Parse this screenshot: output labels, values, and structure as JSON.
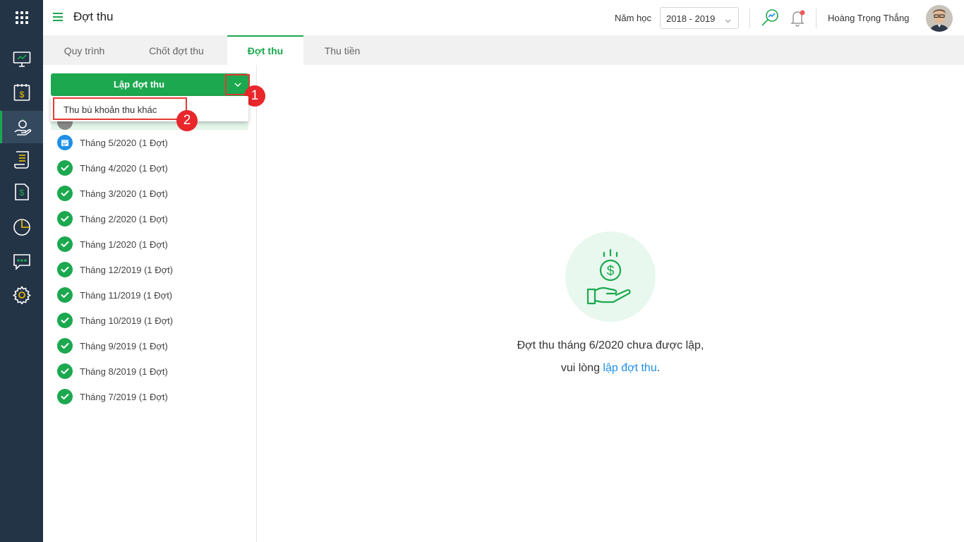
{
  "header": {
    "title": "Đợt thu",
    "year_label": "Năm học",
    "year_value": "2018 - 2019",
    "user_name": "Hoàng Trọng  Thắng"
  },
  "tabs": [
    {
      "label": "Quy trình"
    },
    {
      "label": "Chốt đợt thu"
    },
    {
      "label": "Đợt thu"
    },
    {
      "label": "Thu tiền"
    }
  ],
  "actions": {
    "create_label": "Lập đợt thu",
    "dropdown_item": "Thu bù khoản thu khác"
  },
  "callouts": {
    "one": "1",
    "two": "2"
  },
  "periods": [
    {
      "label": "Tháng 5/2020 (1 Đợt)",
      "status": "current"
    },
    {
      "label": "Tháng 4/2020 (1 Đợt)",
      "status": "done"
    },
    {
      "label": "Tháng 3/2020 (1 Đợt)",
      "status": "done"
    },
    {
      "label": "Tháng 2/2020 (1 Đợt)",
      "status": "done"
    },
    {
      "label": "Tháng 1/2020 (1 Đợt)",
      "status": "done"
    },
    {
      "label": "Tháng 12/2019 (1 Đợt)",
      "status": "done"
    },
    {
      "label": "Tháng 11/2019 (1 Đợt)",
      "status": "done"
    },
    {
      "label": "Tháng 10/2019 (1 Đợt)",
      "status": "done"
    },
    {
      "label": "Tháng 9/2019 (1 Đợt)",
      "status": "done"
    },
    {
      "label": "Tháng 8/2019 (1 Đợt)",
      "status": "done"
    },
    {
      "label": "Tháng 7/2019 (1 Đợt)",
      "status": "done"
    }
  ],
  "empty_state": {
    "line1": "Đợt thu tháng 6/2020 chưa được lập,",
    "line2_prefix": "vui lòng ",
    "line2_link": "lập đợt thu",
    "line2_suffix": "."
  },
  "colors": {
    "accent": "#1ca84f",
    "sidebar": "#243447",
    "link": "#1e8fe8",
    "highlight": "#e53935"
  },
  "icons": {
    "rail": [
      "apps-grid-icon",
      "monitor-icon",
      "calendar-money-icon",
      "hand-coin-icon",
      "receipt-list-icon",
      "invoice-icon",
      "pie-chart-icon",
      "chat-icon",
      "settings-gear-icon"
    ],
    "header": [
      "hamburger-icon",
      "search-chart-icon",
      "bell-icon"
    ]
  }
}
